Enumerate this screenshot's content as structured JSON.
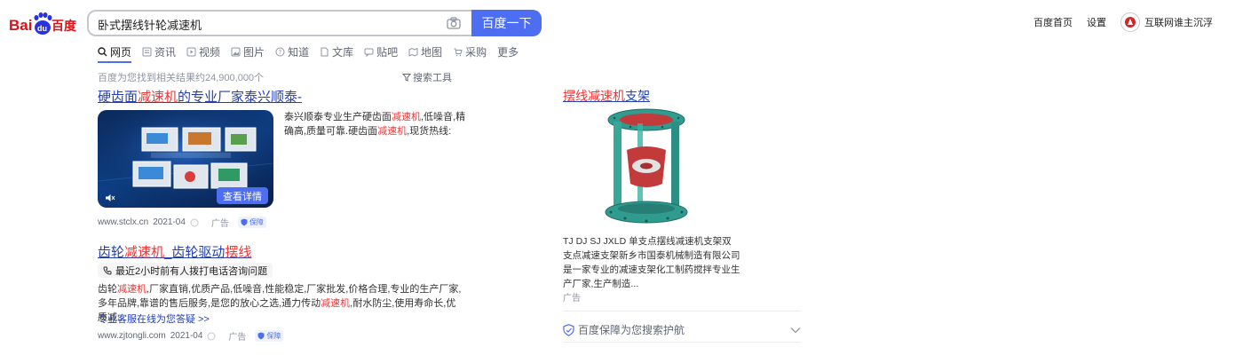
{
  "header": {
    "logo_text": "Bai du 百度",
    "search_value": "卧式摆线针轮减速机",
    "search_button": "百度一下",
    "home_link": "百度首页",
    "settings_link": "设置",
    "username": "互联网谁主沉浮"
  },
  "tabs": [
    {
      "label": "网页",
      "icon": "search-icon",
      "active": true
    },
    {
      "label": "资讯",
      "icon": "news-icon"
    },
    {
      "label": "视频",
      "icon": "video-icon"
    },
    {
      "label": "图片",
      "icon": "image-icon"
    },
    {
      "label": "知道",
      "icon": "question-icon"
    },
    {
      "label": "文库",
      "icon": "doc-icon"
    },
    {
      "label": "贴吧",
      "icon": "forum-icon"
    },
    {
      "label": "地图",
      "icon": "map-icon"
    },
    {
      "label": "采购",
      "icon": "purchase-icon"
    },
    {
      "label": "更多",
      "icon": ""
    }
  ],
  "results_meta": {
    "count_text": "百度为您找到相关结果约24,900,000个",
    "tools_label": "搜索工具"
  },
  "result1": {
    "title_a": "硬齿面",
    "title_hl": "减速机",
    "title_b": "的专业厂家泰兴顺泰-",
    "desc_a": "泰兴顺泰专业生产硬齿面",
    "desc_hl1": "减速机",
    "desc_b": ",低噪音,精确高,质量可靠.硬齿面",
    "desc_hl2": "减速机",
    "desc_c": ",现货热线:",
    "video_button": "查看详情",
    "url": "www.stclx.cn",
    "date": "2021-04",
    "ad": "广告",
    "badge": "保障"
  },
  "result2": {
    "title_a": "齿轮",
    "title_hl1": "减速机",
    "title_b": "_齿轮驱动",
    "title_hl2": "摆线",
    "tel_tag": "最近2小时前有人拨打电话咨询问题",
    "desc_a": "齿轮",
    "desc_hl1": "减速机",
    "desc_b": ",厂家直销,优质产品,低噪音,性能稳定,厂家批发,价格合理,专业的生产厂家,多年品牌,靠谱的售后服务,是您的放心之选,通力传动",
    "desc_hl2": "减速机",
    "desc_c": ",耐水防尘,使用寿命长,优质减...",
    "service_link": "专业客服在线为您答疑 >>",
    "url": "www.zjtongli.com",
    "date": "2021-04",
    "ad": "广告",
    "badge": "保障"
  },
  "right_card": {
    "title_hl": "摆线减速机",
    "title_b": "支架",
    "desc": "TJ DJ SJ JXLD 单支点摆线减速机支架双支点减速支架新乡市国泰机械制造有限公司是一家专业的减速支架化工制药搅拌专业生产厂家,生产制造...",
    "ad": "广告",
    "protect_text": "百度保障为您搜索护航"
  },
  "colors": {
    "brand_blue": "#4e6ef2",
    "link_blue": "#2440b3",
    "highlight_red": "#f73131",
    "logo_red": "#de0f17"
  }
}
